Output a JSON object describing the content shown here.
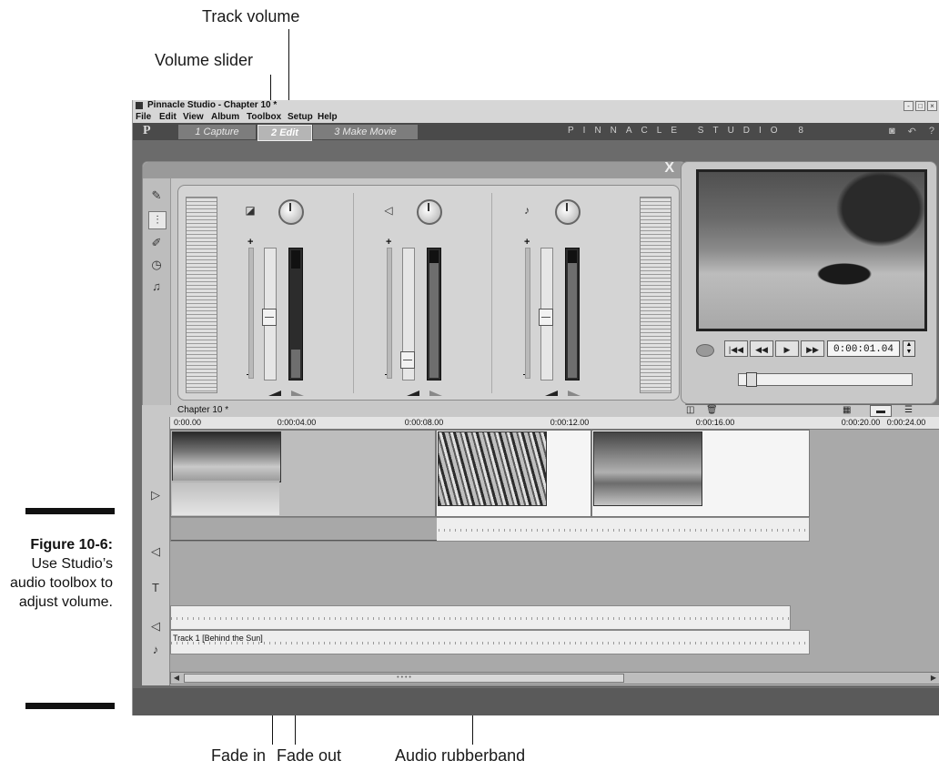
{
  "callouts": {
    "track_volume": "Track volume",
    "volume_slider": "Volume slider",
    "fade_in": "Fade in",
    "fade_out": "Fade out",
    "audio_rubberband": "Audio rubberband"
  },
  "figure": {
    "label": "Figure 10-6:",
    "caption": "Use Studio’s audio toolbox to adjust volume."
  },
  "window": {
    "title": "Pinnacle Studio - Chapter 10 *",
    "controls": [
      "-",
      "□",
      "×"
    ]
  },
  "menu": [
    "File",
    "Edit",
    "View",
    "Album",
    "Toolbox",
    "Setup",
    "Help"
  ],
  "tabs": {
    "logo": "P",
    "items": [
      {
        "label": "1 Capture",
        "active": false
      },
      {
        "label": "2 Edit",
        "active": true
      },
      {
        "label": "3 Make Movie",
        "active": false
      }
    ],
    "brand": "PINNACLE STUDIO 8",
    "right_icons": [
      "help-icon",
      "undo-icon",
      "question-icon"
    ]
  },
  "toolbox": {
    "close": "X",
    "tools": [
      "video-tool-icon",
      "audio-mixer-icon",
      "voice-over-icon",
      "timer-icon",
      "music-icon"
    ],
    "channels": [
      {
        "name": "original-audio",
        "icon": "camera-icon",
        "volume": 0.47,
        "level": 0.22
      },
      {
        "name": "sound-effects",
        "icon": "speaker-icon",
        "volume": 0.1,
        "level": 0.9
      },
      {
        "name": "background-music",
        "icon": "music-note-icon",
        "volume": 0.47,
        "level": 0.9
      }
    ],
    "plus": "+"
  },
  "player": {
    "timecode": "0:00:01.04",
    "buttons": [
      "|◀◀",
      "◀◀",
      "▶",
      "▶▶"
    ],
    "scrub_position": 0.04
  },
  "timeline": {
    "project": "Chapter 10 *",
    "ruler": [
      "0:00.00",
      "0:00:04.00",
      "0:00:08.00",
      "0:00:12.00",
      "0:00:16.00",
      "0:00:20.00",
      "0:00:24.00"
    ],
    "music_track": "Track 1 [Behind the Sun]",
    "scroll_dots": "• • • •"
  },
  "colors": {
    "app_bg": "#6b6b6b",
    "panel": "#c8c8c8",
    "track_bg": "#a9a9a9"
  }
}
